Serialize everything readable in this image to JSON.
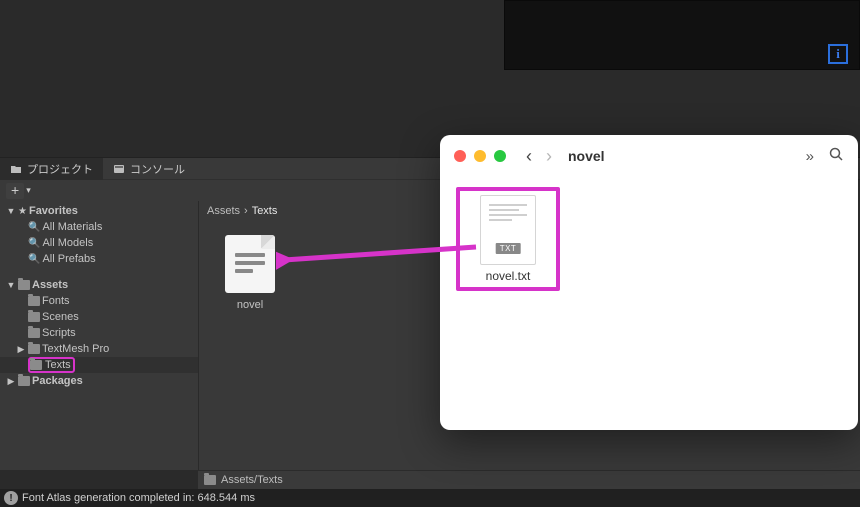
{
  "tabs": {
    "project": "プロジェクト",
    "console": "コンソール"
  },
  "sidebar": {
    "favorites": "Favorites",
    "fav_items": [
      "All Materials",
      "All Models",
      "All Prefabs"
    ],
    "assets": "Assets",
    "asset_folders": [
      "Fonts",
      "Scenes",
      "Scripts",
      "TextMesh Pro",
      "Texts"
    ],
    "packages": "Packages"
  },
  "breadcrumb": {
    "root": "Assets",
    "sep": "›",
    "current": "Texts"
  },
  "asset": {
    "name": "novel"
  },
  "bottom_path": "Assets/Texts",
  "status": "Font Atlas generation completed in: 648.544 ms",
  "finder": {
    "title": "novel",
    "file_name": "novel.txt",
    "file_badge": "TXT"
  }
}
